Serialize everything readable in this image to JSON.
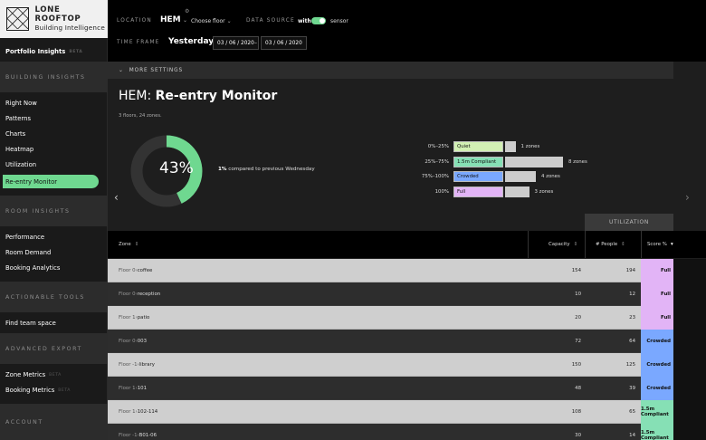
{
  "brand": {
    "name": "LONE ROOFTOP",
    "tagline": "Building Intelligence"
  },
  "sidebar": {
    "portfolio": {
      "label": "Portfolio Insights",
      "badge": "BETA"
    },
    "sections": [
      {
        "title": "BUILDING INSIGHTS"
      },
      {
        "title": "ROOM INSIGHTS"
      },
      {
        "title": "ACTIONABLE TOOLS"
      },
      {
        "title": "ADVANCED EXPORT"
      },
      {
        "title": "ACCOUNT"
      }
    ],
    "building_items": [
      "Right Now",
      "Patterns",
      "Charts",
      "Heatmap",
      "Utilization",
      "Re-entry Monitor"
    ],
    "room_items": [
      "Performance",
      "Room Demand",
      "Booking Analytics"
    ],
    "action_items": [
      "Find team space"
    ],
    "export_items": [
      {
        "label": "Zone Metrics",
        "badge": "BETA"
      },
      {
        "label": "Booking Metrics",
        "badge": "BETA"
      }
    ]
  },
  "header": {
    "location_label": "LOCATION",
    "location_value": "HEM",
    "floor_select": "Choose floor",
    "source_label": "DATA SOURCE",
    "source_with": "with",
    "source_value": "sensor",
    "timeframe_label": "TIME FRAME",
    "timeframe_value": "Yesterday",
    "date_from": "03 / 06 / 2020",
    "date_sep": "–",
    "date_to": "03 / 06 / 2020"
  },
  "more_settings": "MORE SETTINGS",
  "page": {
    "title_prefix": "HEM:",
    "title_main": "Re-entry Monitor",
    "subtitle": "3 floors, 24 zones.",
    "percent": "43%",
    "percent_value": 43,
    "compare_bold": "1%",
    "compare_text": "compared to previous Wednesday"
  },
  "legend": [
    {
      "range": "0%–25%",
      "label": "Quiet",
      "color": "#d2f0b4",
      "count": "1 zones",
      "zones": 1
    },
    {
      "range": "25%–75%",
      "label": "1.5m Compliant",
      "color": "#86e0b5",
      "count": "8 zones",
      "zones": 8
    },
    {
      "range": "75%–100%",
      "label": "Crowded",
      "color": "#7aa8ff",
      "count": "4 zones",
      "zones": 4
    },
    {
      "range": "100%",
      "label": "Full",
      "color": "#e2b4f6",
      "count": "3 zones",
      "zones": 3
    }
  ],
  "table": {
    "util_header": "UTILIZATION",
    "columns": {
      "zone": "Zone",
      "capacity": "Capacity",
      "people": "# People",
      "score": "Score %"
    },
    "rows": [
      {
        "floor": "Floor 0",
        "zone": "coffee",
        "capacity": "154",
        "people": "194",
        "score": "Full",
        "color": "#e2b4f6"
      },
      {
        "floor": "Floor 0",
        "zone": "reception",
        "capacity": "10",
        "people": "12",
        "score": "Full",
        "color": "#e2b4f6"
      },
      {
        "floor": "Floor 1",
        "zone": "patio",
        "capacity": "20",
        "people": "23",
        "score": "Full",
        "color": "#e2b4f6"
      },
      {
        "floor": "Floor 0",
        "zone": "003",
        "capacity": "72",
        "people": "64",
        "score": "Crowded",
        "color": "#7aa8ff"
      },
      {
        "floor": "Floor -1",
        "zone": "library",
        "capacity": "150",
        "people": "125",
        "score": "Crowded",
        "color": "#7aa8ff"
      },
      {
        "floor": "Floor 1",
        "zone": "101",
        "capacity": "48",
        "people": "39",
        "score": "Crowded",
        "color": "#7aa8ff"
      },
      {
        "floor": "Floor 1",
        "zone": "102-114",
        "capacity": "108",
        "people": "65",
        "score": "1.5m Compliant",
        "color": "#86e0b5"
      },
      {
        "floor": "Floor -1",
        "zone": "B01-06",
        "capacity": "30",
        "people": "14",
        "score": "1.5m Compliant",
        "color": "#86e0b5"
      }
    ]
  },
  "colors": {
    "accent": "#6fd890",
    "full": "#e2b4f6",
    "crowded": "#7aa8ff",
    "compliant": "#86e0b5",
    "quiet": "#d2f0b4"
  }
}
